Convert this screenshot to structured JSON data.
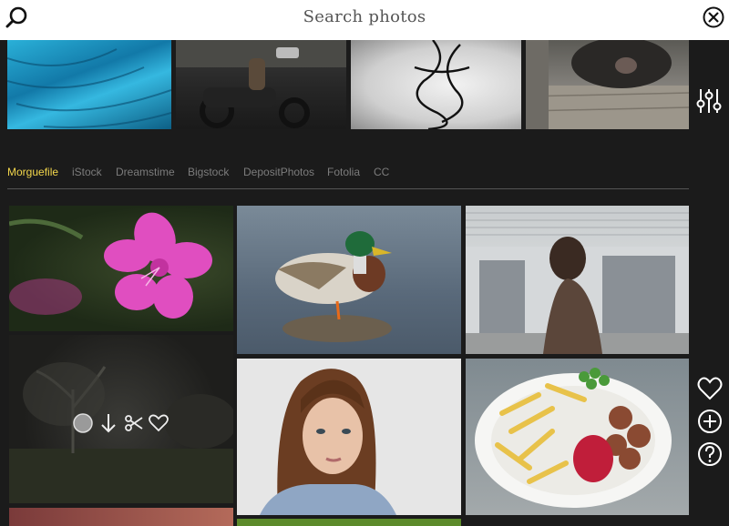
{
  "header": {
    "title": "Search photos",
    "search_icon": "search-icon",
    "close_icon": "close-icon"
  },
  "strip": {
    "thumbnails": [
      "blue-feathers-photo",
      "motorcycle-sidecar-street-photo",
      "ink-smoke-photo",
      "dog-on-dock-photo"
    ]
  },
  "filter_icon": "sliders-icon",
  "sources": {
    "tabs": [
      "Morguefile",
      "iStock",
      "Dreamstime",
      "Bigstock",
      "DepositPhotos",
      "Fotolia",
      "CC"
    ],
    "active": "Morguefile"
  },
  "grid": {
    "photos": [
      "pink-azalea-flower",
      "mallard-duck-on-rock",
      "woman-at-window",
      "foggy-tree-field",
      "girl-portrait",
      "fries-and-meatballs-plate",
      "bottom-left-partial",
      "bottom-middle-partial"
    ],
    "hover_actions": [
      "avatar-icon",
      "download-icon",
      "scissors-icon",
      "heart-icon"
    ]
  },
  "side_actions": [
    "heart-icon",
    "plus-icon",
    "help-icon"
  ],
  "colors": {
    "accent": "#f2d64b",
    "background": "#1b1b1b",
    "tab_inactive": "#7c7c7c"
  }
}
